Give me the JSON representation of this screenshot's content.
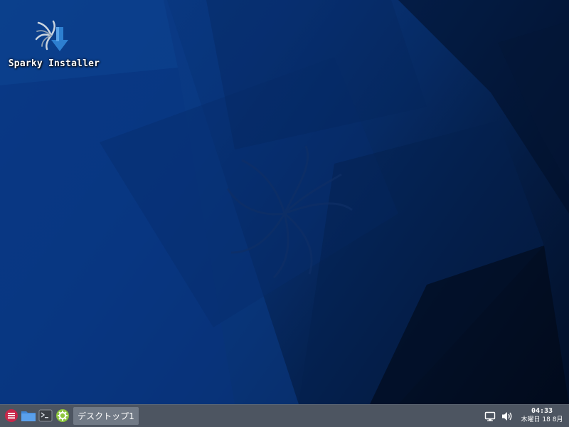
{
  "desktop": {
    "icons": [
      {
        "label": "Sparky Installer",
        "icon": "installer-icon"
      }
    ]
  },
  "taskbar": {
    "launchers": [
      {
        "icon": "menu-icon",
        "color": "#c8264a"
      },
      {
        "icon": "folder-icon",
        "color": "#4a90d9"
      },
      {
        "icon": "terminal-icon",
        "color": "#3b3f45"
      },
      {
        "icon": "settings-icon",
        "color": "#8dc63f"
      }
    ],
    "workspace_label": "デスクトップ1",
    "tray": {
      "display_icon": "display-icon",
      "volume_icon": "volume-icon"
    },
    "clock": {
      "time": "04:33",
      "date": "木曜日 18 8月"
    }
  },
  "colors": {
    "desktop_dark": "#020f26",
    "desktop_blue": "#0a3c88",
    "taskbar_bg": "#4d5561",
    "workspace_bg": "#717a86"
  }
}
